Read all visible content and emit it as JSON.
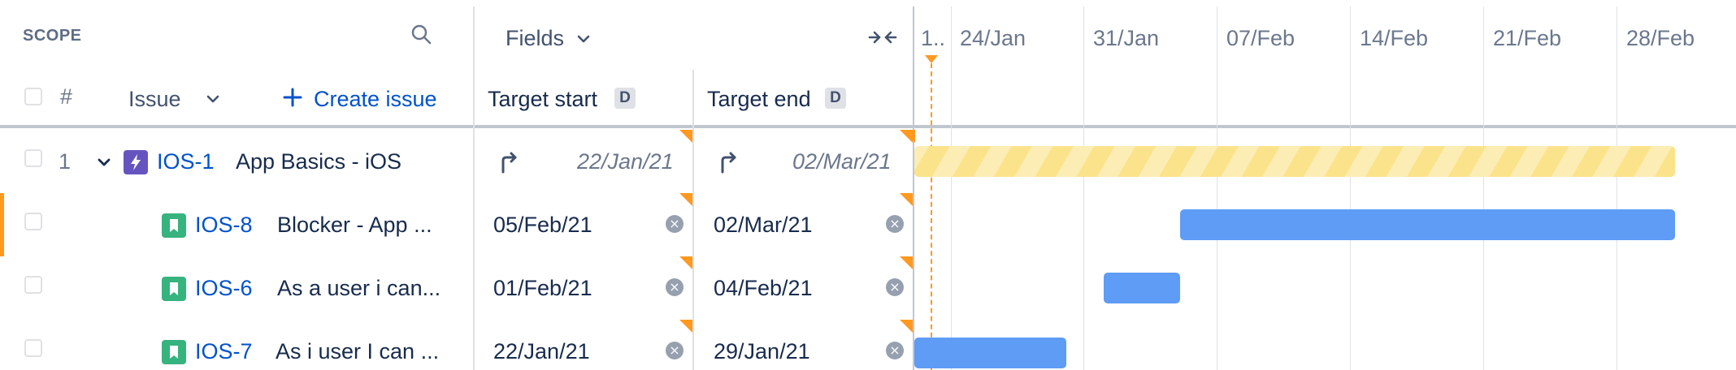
{
  "header": {
    "scope_label": "SCOPE",
    "fields_label": "Fields",
    "number_label": "#",
    "issue_label": "Issue",
    "create_issue_label": "Create issue",
    "target_start_label": "Target start",
    "target_end_label": "Target end",
    "date_badge": "D"
  },
  "timeline": {
    "dates": [
      "1..",
      "24/Jan",
      "31/Jan",
      "07/Feb",
      "14/Feb",
      "21/Feb",
      "28/Feb"
    ]
  },
  "rows": [
    {
      "num": "1",
      "key": "IOS-1",
      "summary": "App Basics - iOS",
      "start": "22/Jan/21",
      "end": "02/Mar/21"
    },
    {
      "num": "",
      "key": "IOS-8",
      "summary": "Blocker - App ...",
      "start": "05/Feb/21",
      "end": "02/Mar/21"
    },
    {
      "num": "",
      "key": "IOS-6",
      "summary": "As a user i can...",
      "start": "01/Feb/21",
      "end": "04/Feb/21"
    },
    {
      "num": "",
      "key": "IOS-7",
      "summary": "As i user I can ...",
      "start": "22/Jan/21",
      "end": "29/Jan/21"
    }
  ],
  "colors": {
    "epic": "#6554c0",
    "story": "#36b37e",
    "bar_blue": "#5e9cf5",
    "bar_yellow": "#fbe38b",
    "accent_orange": "#ff991f"
  }
}
